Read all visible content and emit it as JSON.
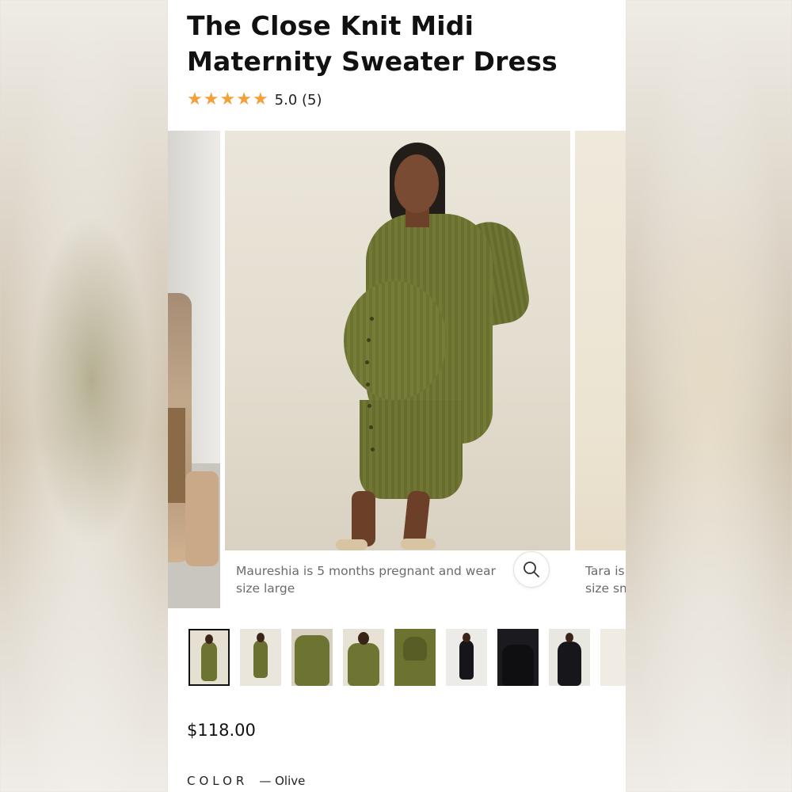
{
  "product": {
    "title_line1": "The Close Knit Midi",
    "title_line2": "Maternity Sweater Dress",
    "rating_stars": 5,
    "rating_text": "5.0 (5)",
    "price": "$118.00",
    "color_label": "COLOR",
    "color_value": "— Olive"
  },
  "carousel": {
    "main_caption_line1": "Maureshia is 5 months pregnant and wear",
    "main_caption_line2": "size large",
    "right_caption_line1": "Tara is",
    "right_caption_line2": "size sm",
    "zoom_icon": "search-icon",
    "thumbnails": [
      {
        "name": "thumb-1",
        "tone": "olive"
      },
      {
        "name": "thumb-2",
        "tone": "olive"
      },
      {
        "name": "thumb-3",
        "tone": "olive"
      },
      {
        "name": "thumb-4",
        "tone": "olive"
      },
      {
        "name": "thumb-5",
        "tone": "olive"
      },
      {
        "name": "thumb-6",
        "tone": "black"
      },
      {
        "name": "thumb-7",
        "tone": "black"
      },
      {
        "name": "thumb-8",
        "tone": "black"
      },
      {
        "name": "thumb-9",
        "tone": "cream"
      }
    ]
  },
  "colors": {
    "star": "#f2a03a",
    "olive": "#6d7331",
    "text": "#111111",
    "caption": "#6b6b6b"
  }
}
